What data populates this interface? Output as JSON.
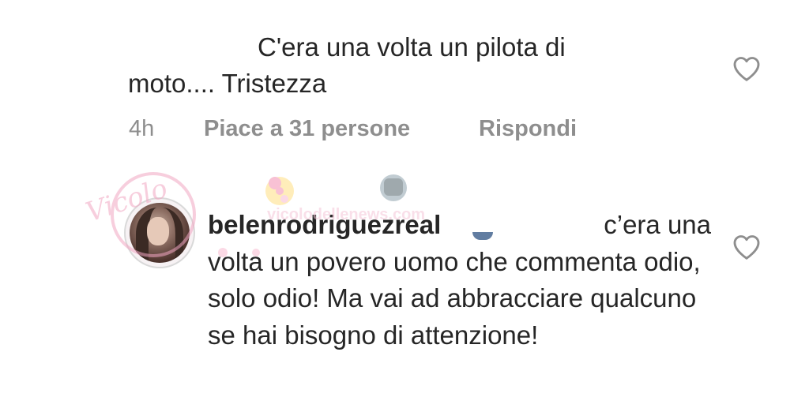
{
  "comments": [
    {
      "text": "C'era una volta un pilota di moto.... Tristezza",
      "text_line1": "C'era una volta un pilota di",
      "text_line2": "moto.... Tristezza",
      "time": "4h",
      "likes_label": "Piace a 31 persone",
      "reply_label": "Rispondi",
      "like_icon": "heart-outline-icon"
    },
    {
      "username": "belenrodriguezreal",
      "text": "c’era una volta un povero uomo che commenta odio, solo odio! Ma vai ad abbracciare qualcuno se hai bisogno di attenzione!",
      "text_first": "c’era",
      "text_rest": "una volta un povero uomo che commenta odio, solo odio! Ma vai ad abbracciare qualcuno se hai bisogno di attenzione!",
      "like_icon": "heart-outline-icon"
    }
  ],
  "watermark": {
    "signature": "Vicolo",
    "site": "vicolodellenews.com"
  },
  "colors": {
    "text": "#262626",
    "meta": "#8e8e8e",
    "background": "#ffffff"
  }
}
